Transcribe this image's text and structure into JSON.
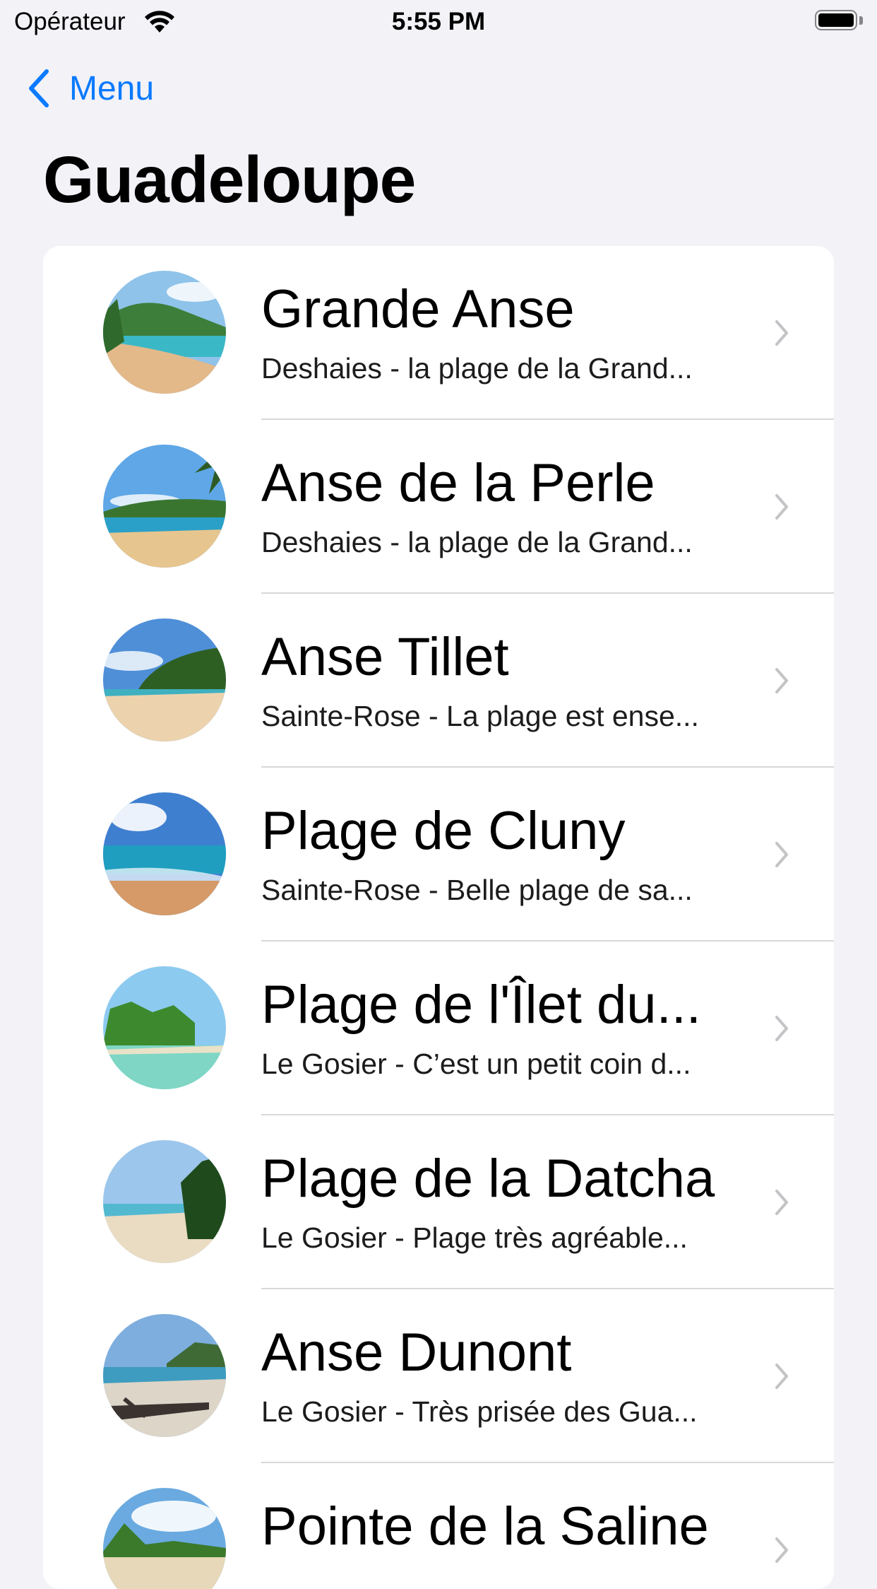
{
  "status_bar": {
    "carrier": "Opérateur",
    "time": "5:55 PM"
  },
  "nav": {
    "back_label": "Menu",
    "title": "Guadeloupe"
  },
  "colors": {
    "accent": "#0a7aff",
    "background": "#f2f2f7",
    "card": "#ffffff",
    "chevron": "#c4c4c7"
  },
  "items": [
    {
      "title": "Grande Anse",
      "subtitle": "Deshaies - la plage de la Grand..."
    },
    {
      "title": "Anse de la Perle",
      "subtitle": "Deshaies - la plage de la Grand..."
    },
    {
      "title": "Anse Tillet",
      "subtitle": "Sainte-Rose - La plage est ense..."
    },
    {
      "title": "Plage de Cluny",
      "subtitle": "Sainte-Rose - Belle plage de sa..."
    },
    {
      "title": "Plage de l'Îlet du...",
      "subtitle": "Le Gosier - C’est un petit coin d..."
    },
    {
      "title": "Plage de la Datcha",
      "subtitle": "Le Gosier - Plage très agréable..."
    },
    {
      "title": "Anse Dunont",
      "subtitle": "Le Gosier - Très prisée des Gua..."
    },
    {
      "title": "Pointe de la Saline",
      "subtitle": ""
    }
  ]
}
